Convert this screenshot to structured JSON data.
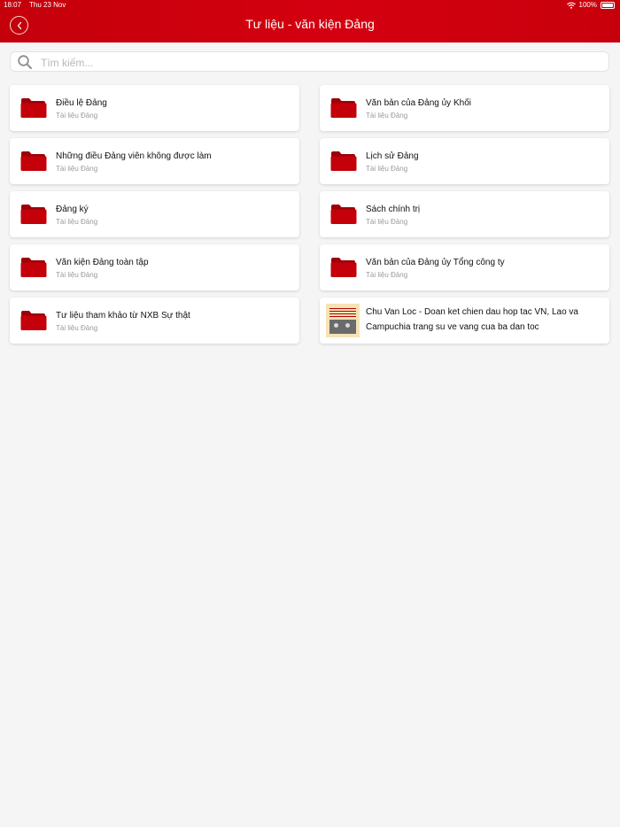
{
  "status_bar": {
    "time": "18:07",
    "date": "Thu 23 Nov",
    "battery": "100%"
  },
  "header": {
    "title": "Tư liệu - văn kiện Đảng",
    "back_icon": "chevron-left-icon"
  },
  "search": {
    "placeholder": "Tìm kiếm..."
  },
  "colors": {
    "brand": "#d10010",
    "folder": "#c4000b",
    "background": "#f5f5f5"
  },
  "items": [
    {
      "title": "Điều lệ Đảng",
      "subtitle": "Tài liệu Đảng",
      "icon": "folder-icon"
    },
    {
      "title": "Văn bản của Đảng ủy Khối",
      "subtitle": "Tài liệu Đảng",
      "icon": "folder-icon"
    },
    {
      "title": "Những điều Đảng viên không được làm",
      "subtitle": "Tài liệu Đảng",
      "icon": "folder-icon"
    },
    {
      "title": "Lịch sử Đảng",
      "subtitle": "Tài liệu Đảng",
      "icon": "folder-icon"
    },
    {
      "title": "Đảng ký",
      "subtitle": "Tài liệu Đảng",
      "icon": "folder-icon"
    },
    {
      "title": "Sách chính trị",
      "subtitle": "Tài liệu Đảng",
      "icon": "folder-icon"
    },
    {
      "title": "Văn kiện Đảng toàn tập",
      "subtitle": "Tài liệu Đảng",
      "icon": "folder-icon"
    },
    {
      "title": "Văn bản của Đảng ủy Tổng công ty",
      "subtitle": "Tài liệu Đảng",
      "icon": "folder-icon"
    },
    {
      "title": "Tư liệu tham khảo từ NXB Sự thật",
      "subtitle": "Tài liệu Đảng",
      "icon": "folder-icon"
    },
    {
      "title": "Chu Van Loc - Doan ket chien dau hop tac VN, Lao va Campuchia trang su ve vang cua ba dan toc",
      "icon": "book-cover-thumbnail"
    }
  ]
}
